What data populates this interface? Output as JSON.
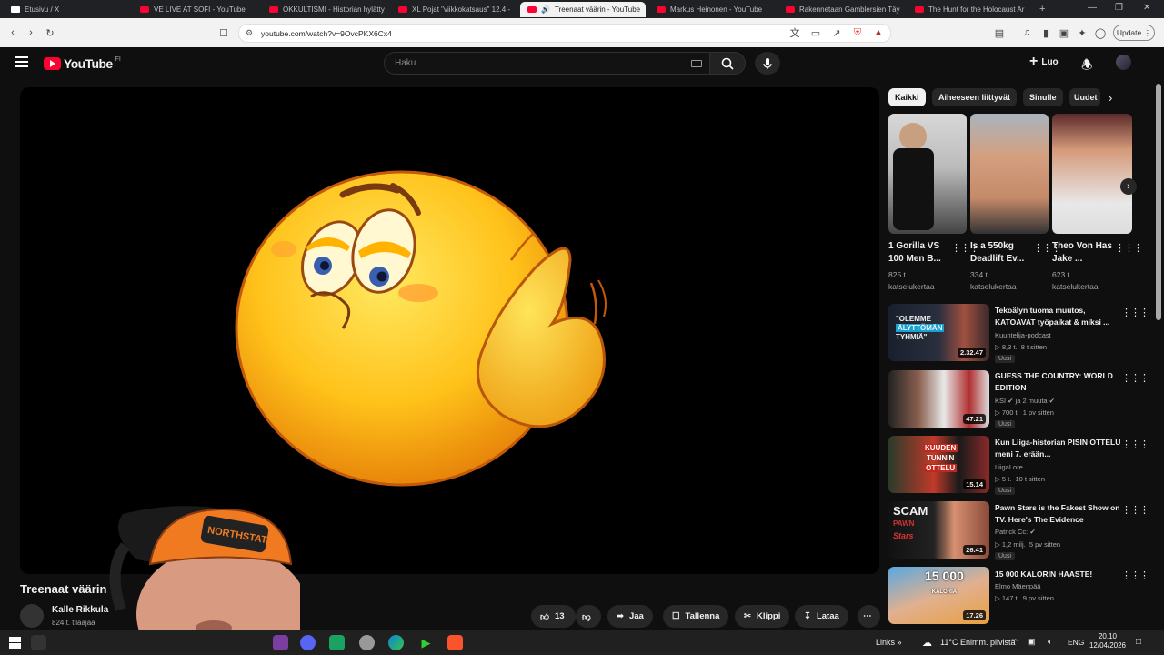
{
  "browser": {
    "tabs": [
      {
        "label": "Etusivu / X",
        "icon": "x-logo-icon"
      },
      {
        "label": "VE LIVE AT SOFI - YouTube",
        "icon": "youtube-favicon-icon"
      },
      {
        "label": "OKKULTISMI - Historian hylätty",
        "icon": "youtube-favicon-icon"
      },
      {
        "label": "XL Pojat \"viikkokatsaus\" 12.4 -",
        "icon": "youtube-favicon-icon"
      },
      {
        "label": "Treenaat väärin - YouTube",
        "icon": "youtube-favicon-icon"
      },
      {
        "label": "Markus Heinonen - YouTube",
        "icon": "youtube-favicon-icon"
      },
      {
        "label": "Rakennetaan Gamblersien Täy",
        "icon": "youtube-favicon-icon"
      },
      {
        "label": "The Hunt for the Holocaust Ar",
        "icon": "youtube-favicon-icon"
      }
    ],
    "url": "youtube.com/watch?v=9OvcPKX6Cx4",
    "update_label": "Update"
  },
  "youtube": {
    "logo_text": "YouTube",
    "country": "FI",
    "search_placeholder": "Haku",
    "create_label": "Luo"
  },
  "video": {
    "title": "Treenaat väärin",
    "channel": "Kalle Rikkula",
    "subscribers": "824 t. tilaajaa",
    "likes": "13",
    "share_label": "Jaa",
    "save_label": "Tallenna",
    "clip_label": "Klippi",
    "download_label": "Lataa"
  },
  "chips": [
    "Kaikki",
    "Aiheeseen liittyvät",
    "Sinulle",
    "Uudet"
  ],
  "shorts": [
    {
      "title": "1 Gorilla VS 100 Men B...",
      "views": "825 t.",
      "views2": "katselukertaa"
    },
    {
      "title": "Is a 550kg Deadlift Ev...",
      "views": "334 t.",
      "views2": "katselukertaa"
    },
    {
      "title": "Theo Von Has Jake ...",
      "views": "623 t.",
      "views2": "katselukertaa"
    }
  ],
  "recommended": [
    {
      "title": "Tekoälyn tuoma muutos, KATOAVAT työpaikat & miksi ...",
      "channel": "Kuuntelija-podcast",
      "views": "8,3 t.",
      "age": "8 t sitten",
      "duration": "2.32.47",
      "badge": "Uusi",
      "thumb_text_1": "\"OLEMME",
      "thumb_text_2": "ÄLYTTÖMÄN",
      "thumb_text_3": "TYHMIÄ\""
    },
    {
      "title": "GUESS THE COUNTRY: WORLD EDITION",
      "channel": "KSI",
      "views": "700 t.",
      "age": "1 pv sitten",
      "duration": "47.21",
      "badge": "Uusi",
      "channel_suffix": "ja 2 muuta"
    },
    {
      "title": "Kun Liiga-historian PISIN OTTELU meni 7. erään...",
      "channel": "LiigaLore",
      "views": "5 t.",
      "age": "10 t sitten",
      "duration": "15.14",
      "badge": "Uusi",
      "thumb_text_1": "KUUDEN",
      "thumb_text_2": "TUNNIN",
      "thumb_text_3": "OTTELU"
    },
    {
      "title": "Pawn Stars is the Fakest Show on TV. Here's The Evidence",
      "channel": "Patrick Cc:",
      "views": "1,2 milj.",
      "age": "5 pv sitten",
      "duration": "26.41",
      "badge": "Uusi",
      "thumb_text_1": "SCAM",
      "thumb_text_2": "PAWN",
      "thumb_text_3": "Stars"
    },
    {
      "title": "15 000 KALORIN HAASTE!",
      "channel": "Elmo Mäenpää",
      "views": "147 t.",
      "age": "9 pv sitten",
      "duration": "17.26",
      "thumb_text_1": "15 000",
      "thumb_text_2": "KALORIA"
    }
  ],
  "taskbar": {
    "links_label": "Links",
    "weather": "11°C  Enimm. pilvistä",
    "lang": "ENG",
    "time": "20.10",
    "date": "12/04/2026"
  },
  "colors": {
    "youtube_red": "#ff0033",
    "background": "#0f0f0f",
    "chip_bg": "#272727"
  }
}
